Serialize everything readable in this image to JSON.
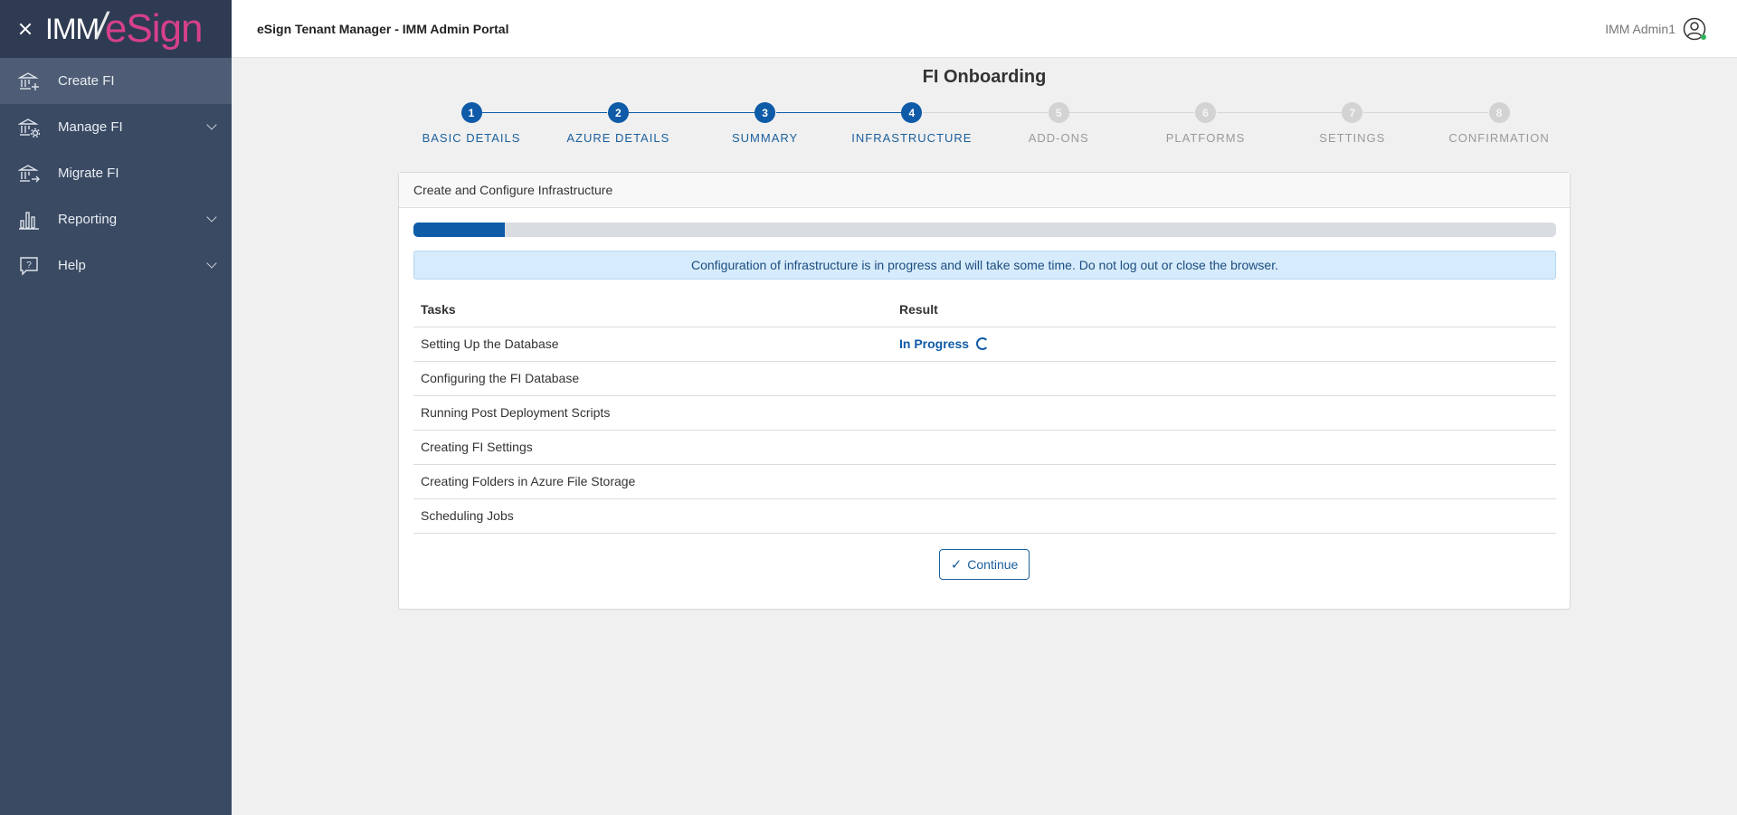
{
  "logo": {
    "part_a": "IMM",
    "part_b": "eSign"
  },
  "sidebar": {
    "items": [
      {
        "label": "Create FI",
        "icon": "bank-plus-icon",
        "active": true
      },
      {
        "label": "Manage FI",
        "icon": "bank-gear-icon",
        "expandable": true
      },
      {
        "label": "Migrate FI",
        "icon": "bank-arrow-icon"
      },
      {
        "label": "Reporting",
        "icon": "bar-chart-icon",
        "expandable": true
      },
      {
        "label": "Help",
        "icon": "help-bubble-icon",
        "expandable": true
      }
    ]
  },
  "header": {
    "title": "eSign Tenant Manager - IMM Admin Portal",
    "user": "IMM Admin1"
  },
  "page": {
    "title": "FI Onboarding"
  },
  "stepper": {
    "current_step": 4,
    "steps": [
      {
        "number": "1",
        "label": "BASIC DETAILS"
      },
      {
        "number": "2",
        "label": "AZURE DETAILS"
      },
      {
        "number": "3",
        "label": "SUMMARY"
      },
      {
        "number": "4",
        "label": "INFRASTRUCTURE"
      },
      {
        "number": "5",
        "label": "ADD-ONS"
      },
      {
        "number": "6",
        "label": "PLATFORMS"
      },
      {
        "number": "7",
        "label": "SETTINGS"
      },
      {
        "number": "8",
        "label": "CONFIRMATION"
      }
    ]
  },
  "card": {
    "title": "Create and Configure Infrastructure",
    "progress_percent": 8,
    "alert": "Configuration of infrastructure is in progress and will take some time. Do not log out or close the browser.",
    "table": {
      "headers": [
        "Tasks",
        "Result"
      ],
      "rows": [
        {
          "task": "Setting Up the Database",
          "result": "In Progress"
        },
        {
          "task": "Configuring the FI Database",
          "result": ""
        },
        {
          "task": "Running Post Deployment Scripts",
          "result": ""
        },
        {
          "task": "Creating FI Settings",
          "result": ""
        },
        {
          "task": "Creating Folders in Azure File Storage",
          "result": ""
        },
        {
          "task": "Scheduling Jobs",
          "result": ""
        }
      ]
    },
    "continue_label": "Continue"
  },
  "colors": {
    "primary": "#0f5ba8",
    "sidebar": "#3a4a63",
    "logo_accent": "#d6408a"
  }
}
